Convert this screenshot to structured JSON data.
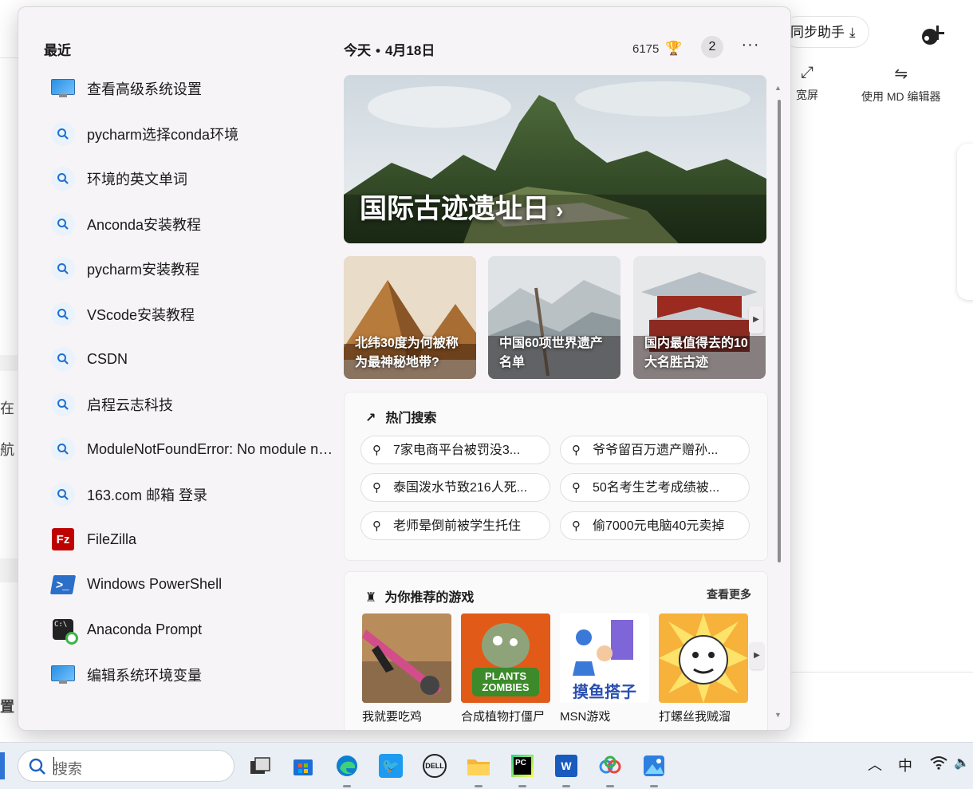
{
  "background": {
    "sync_label": "同步助手",
    "toolbar": {
      "widescreen": "宽屏",
      "md_editor": "使用 MD 编辑器"
    },
    "edge_texts": [
      "在",
      "航",
      "置"
    ]
  },
  "widgets": {
    "recent": {
      "title": "最近",
      "items": [
        {
          "label": "查看高级系统设置",
          "icon": "system-settings-icon"
        },
        {
          "label": "pycharm选择conda环境",
          "icon": "search-icon"
        },
        {
          "label": "环境的英文单词",
          "icon": "search-icon"
        },
        {
          "label": "Anconda安装教程",
          "icon": "search-icon"
        },
        {
          "label": "pycharm安装教程",
          "icon": "search-icon"
        },
        {
          "label": "VScode安装教程",
          "icon": "search-icon"
        },
        {
          "label": "CSDN",
          "icon": "search-icon"
        },
        {
          "label": "启程云志科技",
          "icon": "search-icon"
        },
        {
          "label": "ModuleNotFoundError: No module na...",
          "icon": "search-icon"
        },
        {
          "label": "163.com 邮箱 登录",
          "icon": "search-icon"
        },
        {
          "label": "FileZilla",
          "icon": "filezilla-icon"
        },
        {
          "label": "Windows PowerShell",
          "icon": "powershell-icon"
        },
        {
          "label": "Anaconda Prompt",
          "icon": "anaconda-prompt-icon"
        },
        {
          "label": "编辑系统环境变量",
          "icon": "system-settings-icon"
        }
      ]
    },
    "header": {
      "today": "今天",
      "separator": "•",
      "date": "4月18日",
      "points": "6175",
      "notifications": "2",
      "more": "···"
    },
    "hero": {
      "title": "国际古迹遗址日"
    },
    "cards": [
      {
        "title": "北纬30度为何被称为最神秘地带?"
      },
      {
        "title": "中国60项世界遗产名单"
      },
      {
        "title": "国内最值得去的10大名胜古迹"
      }
    ],
    "trending": {
      "title": "热门搜索",
      "items": [
        "7家电商平台被罚没3...",
        "爷爷留百万遗产赠孙...",
        "泰国泼水节致216人死...",
        "50名考生艺考成绩被...",
        "老师晕倒前被学生托住",
        "偷7000元电脑40元卖掉"
      ]
    },
    "games": {
      "title": "为你推荐的游戏",
      "see_more": "查看更多",
      "items": [
        {
          "name": "我就要吃鸡"
        },
        {
          "name": "合成植物打僵尸",
          "art_text": "PLANTS ZOMBIES"
        },
        {
          "name": "MSN游戏",
          "art_text": "摸鱼搭子"
        },
        {
          "name": "打螺丝我贼溜"
        }
      ]
    }
  },
  "taskbar": {
    "search_placeholder": "搜索",
    "apps": [
      "task-view",
      "microsoft-store",
      "edge",
      "twitter",
      "dell",
      "file-explorer",
      "pycharm",
      "word",
      "baidu-netdisk",
      "photos"
    ],
    "tray": {
      "ime": "中"
    }
  },
  "colors": {
    "accent": "#2e74d6",
    "panel_bg": "#f6f4f6",
    "taskbar_bg": "#e9eff4"
  }
}
